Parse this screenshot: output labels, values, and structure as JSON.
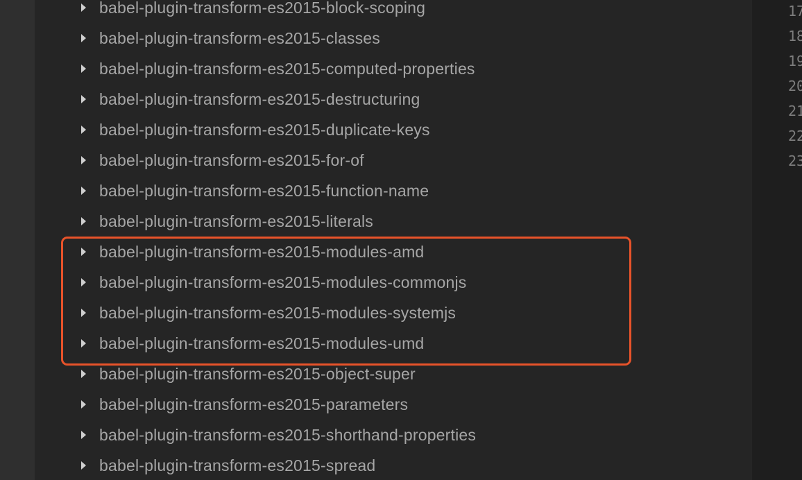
{
  "explorer": {
    "items": [
      {
        "label": "babel-plugin-transform-es2015-block-scoping"
      },
      {
        "label": "babel-plugin-transform-es2015-classes"
      },
      {
        "label": "babel-plugin-transform-es2015-computed-properties"
      },
      {
        "label": "babel-plugin-transform-es2015-destructuring"
      },
      {
        "label": "babel-plugin-transform-es2015-duplicate-keys"
      },
      {
        "label": "babel-plugin-transform-es2015-for-of"
      },
      {
        "label": "babel-plugin-transform-es2015-function-name"
      },
      {
        "label": "babel-plugin-transform-es2015-literals"
      },
      {
        "label": "babel-plugin-transform-es2015-modules-amd"
      },
      {
        "label": "babel-plugin-transform-es2015-modules-commonjs"
      },
      {
        "label": "babel-plugin-transform-es2015-modules-systemjs"
      },
      {
        "label": "babel-plugin-transform-es2015-modules-umd"
      },
      {
        "label": "babel-plugin-transform-es2015-object-super"
      },
      {
        "label": "babel-plugin-transform-es2015-parameters"
      },
      {
        "label": "babel-plugin-transform-es2015-shorthand-properties"
      },
      {
        "label": "babel-plugin-transform-es2015-spread"
      }
    ],
    "chevron_icon": "chevron-right-icon"
  },
  "highlight": {
    "color": "#e8532a"
  },
  "editor": {
    "line_numbers": [
      "17",
      "18",
      "19",
      "20",
      "21",
      "22",
      "23"
    ]
  },
  "colors": {
    "sidebar_bg": "#252525",
    "item_text": "#a6a6a6",
    "chevron": "#cfcfcf",
    "line_number": "#7d7d7d"
  }
}
